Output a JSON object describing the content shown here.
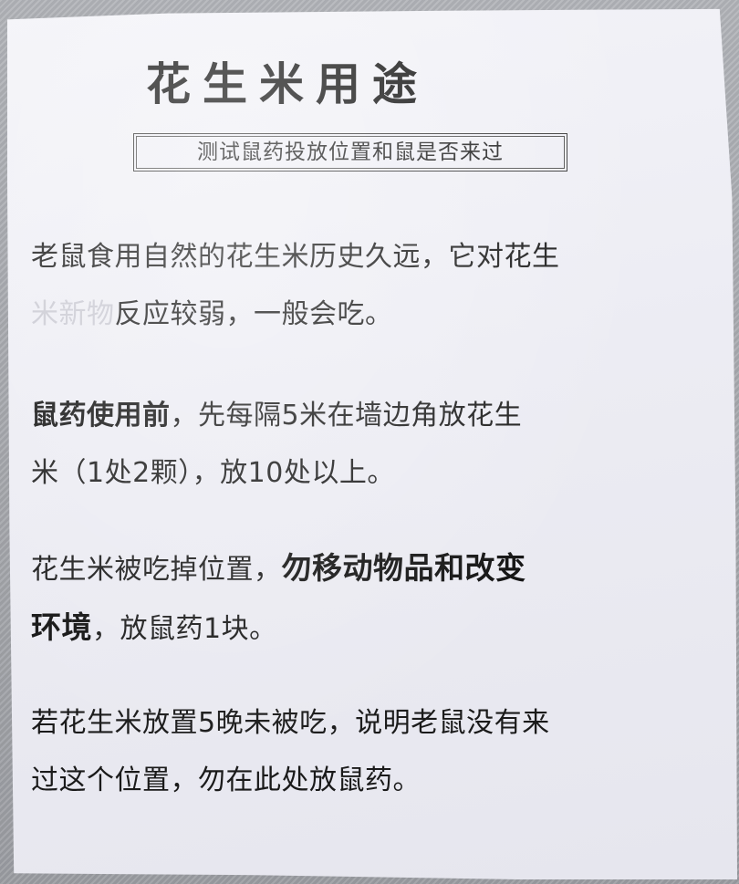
{
  "title": "花生米用途",
  "subtitle": "测试鼠药投放位置和鼠是否来过",
  "paragraph1": {
    "line1": "老鼠食用自然的花生米历史久远，它对花生",
    "faded": "米新物",
    "line2_rest": "反应较弱，一般会吃。"
  },
  "paragraph2": {
    "bold": "鼠药使用前",
    "rest1": "，先每隔5米在墙边角放花生",
    "line2": "米（1处2颗），放10处以上。"
  },
  "paragraph3": {
    "start": "花生米被吃掉位置，",
    "bold1": "勿移动物品和改变",
    "bold2": "环境",
    "end": "，放鼠药1块。"
  },
  "paragraph4": {
    "line1": "若花生米放置5晚未被吃，说明老鼠没有来",
    "line2": "过这个位置，勿在此处放鼠药。"
  }
}
